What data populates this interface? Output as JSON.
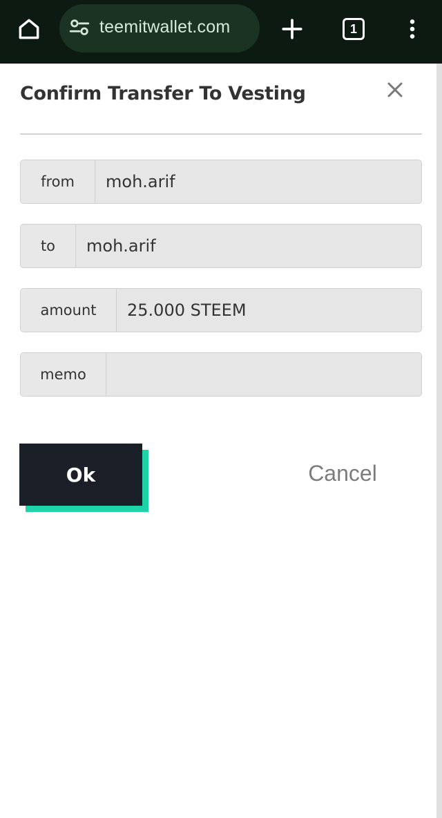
{
  "browser": {
    "url": "teemitwallet.com",
    "tab_count": "1",
    "icons": {
      "home": "home-icon",
      "site_settings": "site-settings-icon",
      "new_tab": "plus-icon",
      "tabs": "tab-switcher-icon",
      "menu": "more-vert-icon"
    }
  },
  "dialog": {
    "title": "Confirm Transfer To Vesting",
    "close_icon": "close-icon",
    "fields": [
      {
        "label": "from",
        "value": "moh.arif"
      },
      {
        "label": "to",
        "value": "moh.arif"
      },
      {
        "label": "amount",
        "value": "25.000 STEEM"
      },
      {
        "label": "memo",
        "value": ""
      }
    ],
    "ok_label": "Ok",
    "cancel_label": "Cancel"
  },
  "colors": {
    "browser_bar": "#0c1a11",
    "url_pill": "#1a3322",
    "ok_button": "#1a1f28",
    "ok_accent": "#1fd3a9",
    "cancel_text": "#7c7c7c"
  }
}
